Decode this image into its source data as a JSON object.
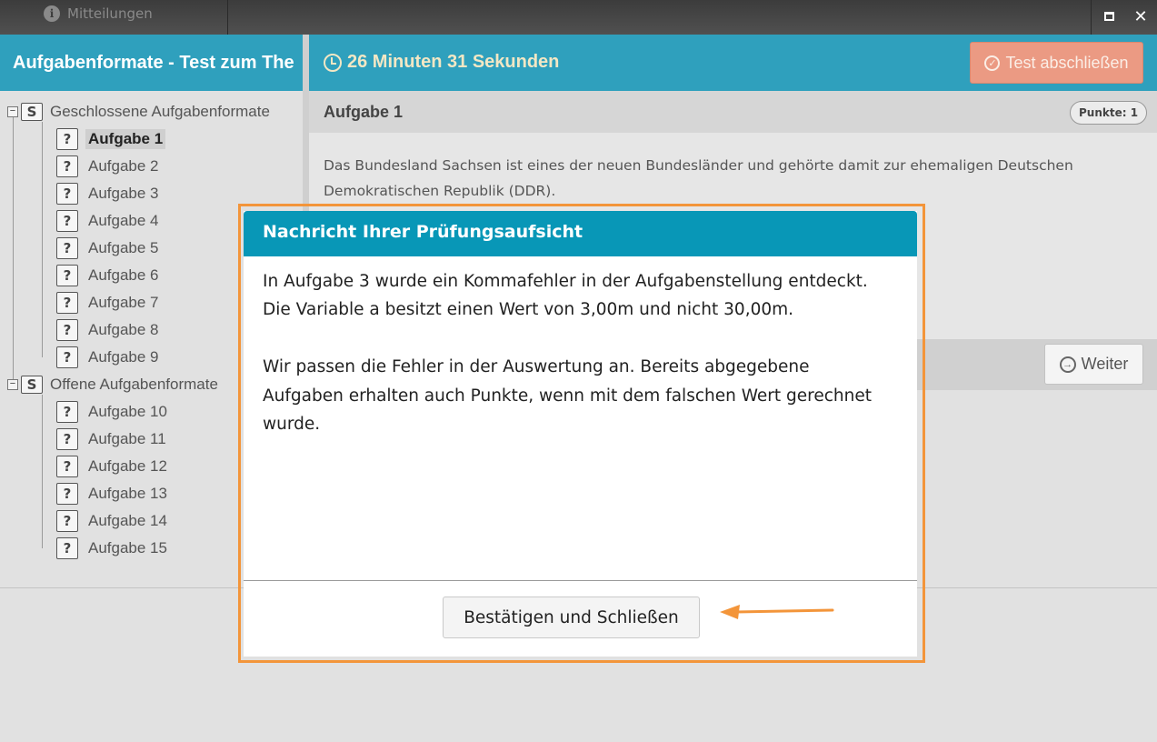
{
  "window": {
    "notification_label": "Mitteilungen",
    "maximize_icon": "maximize-icon",
    "close_icon": "close-icon"
  },
  "sidebar": {
    "title": "Aufgabenformate - Test zum The",
    "groups": [
      {
        "label": "Geschlossene Aufgabenformate",
        "items": [
          "Aufgabe 1",
          "Aufgabe 2",
          "Aufgabe 3",
          "Aufgabe 4",
          "Aufgabe 5",
          "Aufgabe 6",
          "Aufgabe 7",
          "Aufgabe 8",
          "Aufgabe 9"
        ]
      },
      {
        "label": "Offene Aufgabenformate",
        "items": [
          "Aufgabe 10",
          "Aufgabe 11",
          "Aufgabe 12",
          "Aufgabe 13",
          "Aufgabe 14",
          "Aufgabe 15"
        ]
      }
    ],
    "active_item": "Aufgabe 1"
  },
  "header": {
    "timer": "26 Minuten 31 Sekunden",
    "finish_button": "Test abschließen"
  },
  "task": {
    "title": "Aufgabe 1",
    "points": "Punkte: 1",
    "text": "Das Bundesland Sachsen ist eines der neuen Bundesländer und gehörte damit zur ehemaligen Deutschen Demokratischen Republik (DDR).",
    "next_button": "Weiter"
  },
  "modal": {
    "title": "Nachricht Ihrer Prüfungsaufsicht",
    "paragraph_1": "In Aufgabe 3 wurde ein Kommafehler in der Aufgabenstellung entdeckt. Die Variable a besitzt einen Wert von 3,00m und nicht 30,00m.",
    "paragraph_2": "Wir passen die Fehler in der Auswertung an. Bereits abgegebene Aufgaben erhalten auch Punkte, wenn mit dem falschen Wert gerechnet wurde.",
    "confirm_button": "Bestätigen und Schließen"
  },
  "colors": {
    "header_teal": "#2fa0bd",
    "modal_header": "#0897b7",
    "finish_button": "#eb9a83",
    "annotation_orange": "#f3953a",
    "timer_text": "#f3e7c4"
  }
}
